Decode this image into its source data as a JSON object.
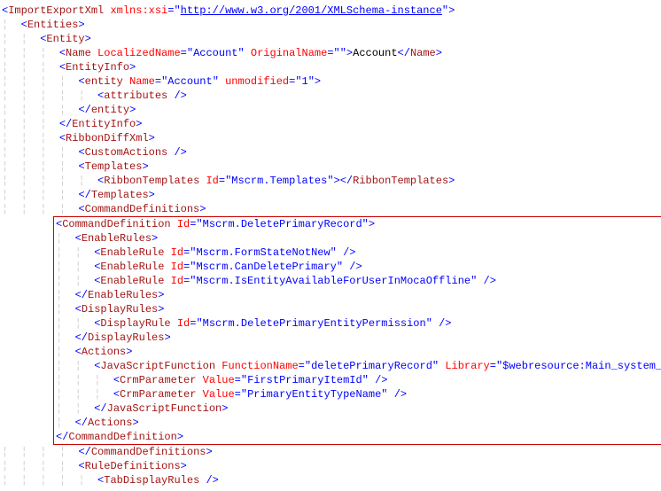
{
  "lines": {
    "l1": {
      "indent": "",
      "parts": [
        [
          "pun",
          "<"
        ],
        [
          "tag",
          "ImportExportXml"
        ],
        [
          "text",
          " "
        ],
        [
          "attrname",
          "xmlns:xsi"
        ],
        [
          "pun",
          "="
        ],
        [
          "attrval",
          "\""
        ],
        [
          "link",
          "http://www.w3.org/2001/XMLSchema-instance"
        ],
        [
          "attrval",
          "\""
        ],
        [
          "pun",
          ">"
        ]
      ]
    },
    "l2": {
      "indent": "·",
      "parts": [
        [
          "pun",
          "<"
        ],
        [
          "tag",
          "Entities"
        ],
        [
          "pun",
          ">"
        ]
      ]
    },
    "l3": {
      "indent": "··",
      "parts": [
        [
          "pun",
          "<"
        ],
        [
          "tag",
          "Entity"
        ],
        [
          "pun",
          ">"
        ]
      ]
    },
    "l4": {
      "indent": "···",
      "parts": [
        [
          "pun",
          "<"
        ],
        [
          "tag",
          "Name"
        ],
        [
          "text",
          " "
        ],
        [
          "attrname",
          "LocalizedName"
        ],
        [
          "pun",
          "="
        ],
        [
          "attrval",
          "\"Account\""
        ],
        [
          "text",
          " "
        ],
        [
          "attrname",
          "OriginalName"
        ],
        [
          "pun",
          "="
        ],
        [
          "attrval",
          "\"\""
        ],
        [
          "pun",
          ">"
        ],
        [
          "text",
          "Account"
        ],
        [
          "pun",
          "</"
        ],
        [
          "tag",
          "Name"
        ],
        [
          "pun",
          ">"
        ]
      ]
    },
    "l5": {
      "indent": "···",
      "parts": [
        [
          "pun",
          "<"
        ],
        [
          "tag",
          "EntityInfo"
        ],
        [
          "pun",
          ">"
        ]
      ]
    },
    "l6": {
      "indent": "····",
      "parts": [
        [
          "pun",
          "<"
        ],
        [
          "tag",
          "entity"
        ],
        [
          "text",
          " "
        ],
        [
          "attrname",
          "Name"
        ],
        [
          "pun",
          "="
        ],
        [
          "attrval",
          "\"Account\""
        ],
        [
          "text",
          " "
        ],
        [
          "attrname",
          "unmodified"
        ],
        [
          "pun",
          "="
        ],
        [
          "attrval",
          "\"1\""
        ],
        [
          "pun",
          ">"
        ]
      ]
    },
    "l7": {
      "indent": "·····",
      "parts": [
        [
          "pun",
          "<"
        ],
        [
          "tag",
          "attributes"
        ],
        [
          "text",
          " "
        ],
        [
          "pun",
          "/>"
        ]
      ]
    },
    "l8": {
      "indent": "····",
      "parts": [
        [
          "pun",
          "</"
        ],
        [
          "tag",
          "entity"
        ],
        [
          "pun",
          ">"
        ]
      ]
    },
    "l9": {
      "indent": "···",
      "parts": [
        [
          "pun",
          "</"
        ],
        [
          "tag",
          "EntityInfo"
        ],
        [
          "pun",
          ">"
        ]
      ]
    },
    "l10": {
      "indent": "···",
      "parts": [
        [
          "pun",
          "<"
        ],
        [
          "tag",
          "RibbonDiffXml"
        ],
        [
          "pun",
          ">"
        ]
      ]
    },
    "l11": {
      "indent": "····",
      "parts": [
        [
          "pun",
          "<"
        ],
        [
          "tag",
          "CustomActions"
        ],
        [
          "text",
          " "
        ],
        [
          "pun",
          "/>"
        ]
      ]
    },
    "l12": {
      "indent": "····",
      "parts": [
        [
          "pun",
          "<"
        ],
        [
          "tag",
          "Templates"
        ],
        [
          "pun",
          ">"
        ]
      ]
    },
    "l13": {
      "indent": "·····",
      "parts": [
        [
          "pun",
          "<"
        ],
        [
          "tag",
          "RibbonTemplates"
        ],
        [
          "text",
          " "
        ],
        [
          "attrname",
          "Id"
        ],
        [
          "pun",
          "="
        ],
        [
          "attrval",
          "\"Mscrm.Templates\""
        ],
        [
          "pun",
          ">"
        ],
        [
          "pun",
          "</"
        ],
        [
          "tag",
          "RibbonTemplates"
        ],
        [
          "pun",
          ">"
        ]
      ]
    },
    "l14": {
      "indent": "····",
      "parts": [
        [
          "pun",
          "</"
        ],
        [
          "tag",
          "Templates"
        ],
        [
          "pun",
          ">"
        ]
      ]
    },
    "l15": {
      "indent": "····",
      "parts": [
        [
          "pun",
          "<"
        ],
        [
          "tag",
          "CommandDefinitions"
        ],
        [
          "pun",
          ">"
        ]
      ]
    },
    "l16": {
      "indent": "",
      "parts": [
        [
          "pun",
          "<"
        ],
        [
          "tag",
          "CommandDefinition"
        ],
        [
          "text",
          " "
        ],
        [
          "attrname",
          "Id"
        ],
        [
          "pun",
          "="
        ],
        [
          "attrval",
          "\"Mscrm.DeletePrimaryRecord\""
        ],
        [
          "pun",
          ">"
        ]
      ]
    },
    "l17": {
      "indent": "·",
      "parts": [
        [
          "pun",
          "<"
        ],
        [
          "tag",
          "EnableRules"
        ],
        [
          "pun",
          ">"
        ]
      ]
    },
    "l18": {
      "indent": "··",
      "parts": [
        [
          "pun",
          "<"
        ],
        [
          "tag",
          "EnableRule"
        ],
        [
          "text",
          " "
        ],
        [
          "attrname",
          "Id"
        ],
        [
          "pun",
          "="
        ],
        [
          "attrval",
          "\"Mscrm.FormStateNotNew\""
        ],
        [
          "text",
          " "
        ],
        [
          "pun",
          "/>"
        ]
      ]
    },
    "l19": {
      "indent": "··",
      "parts": [
        [
          "pun",
          "<"
        ],
        [
          "tag",
          "EnableRule"
        ],
        [
          "text",
          " "
        ],
        [
          "attrname",
          "Id"
        ],
        [
          "pun",
          "="
        ],
        [
          "attrval",
          "\"Mscrm.CanDeletePrimary\""
        ],
        [
          "text",
          " "
        ],
        [
          "pun",
          "/>"
        ]
      ]
    },
    "l20": {
      "indent": "··",
      "parts": [
        [
          "pun",
          "<"
        ],
        [
          "tag",
          "EnableRule"
        ],
        [
          "text",
          " "
        ],
        [
          "attrname",
          "Id"
        ],
        [
          "pun",
          "="
        ],
        [
          "attrval",
          "\"Mscrm.IsEntityAvailableForUserInMocaOffline\""
        ],
        [
          "text",
          " "
        ],
        [
          "pun",
          "/>"
        ]
      ]
    },
    "l21": {
      "indent": "·",
      "parts": [
        [
          "pun",
          "</"
        ],
        [
          "tag",
          "EnableRules"
        ],
        [
          "pun",
          ">"
        ]
      ]
    },
    "l22": {
      "indent": "·",
      "parts": [
        [
          "pun",
          "<"
        ],
        [
          "tag",
          "DisplayRules"
        ],
        [
          "pun",
          ">"
        ]
      ]
    },
    "l23": {
      "indent": "··",
      "parts": [
        [
          "pun",
          "<"
        ],
        [
          "tag",
          "DisplayRule"
        ],
        [
          "text",
          " "
        ],
        [
          "attrname",
          "Id"
        ],
        [
          "pun",
          "="
        ],
        [
          "attrval",
          "\"Mscrm.DeletePrimaryEntityPermission\""
        ],
        [
          "text",
          " "
        ],
        [
          "pun",
          "/>"
        ]
      ]
    },
    "l24": {
      "indent": "·",
      "parts": [
        [
          "pun",
          "</"
        ],
        [
          "tag",
          "DisplayRules"
        ],
        [
          "pun",
          ">"
        ]
      ]
    },
    "l25": {
      "indent": "·",
      "parts": [
        [
          "pun",
          "<"
        ],
        [
          "tag",
          "Actions"
        ],
        [
          "pun",
          ">"
        ]
      ]
    },
    "l26": {
      "indent": "··",
      "parts": [
        [
          "pun",
          "<"
        ],
        [
          "tag",
          "JavaScriptFunction"
        ],
        [
          "text",
          " "
        ],
        [
          "attrname",
          "FunctionName"
        ],
        [
          "pun",
          "="
        ],
        [
          "attrval",
          "\"deletePrimaryRecord\""
        ],
        [
          "text",
          " "
        ],
        [
          "attrname",
          "Library"
        ],
        [
          "pun",
          "="
        ],
        [
          "attrval",
          "\"$webresource:Main_system_library.js\""
        ],
        [
          "pun",
          ">"
        ]
      ]
    },
    "l27": {
      "indent": "···",
      "parts": [
        [
          "pun",
          "<"
        ],
        [
          "tag",
          "CrmParameter"
        ],
        [
          "text",
          " "
        ],
        [
          "attrname",
          "Value"
        ],
        [
          "pun",
          "="
        ],
        [
          "attrval",
          "\"FirstPrimaryItemId\""
        ],
        [
          "text",
          " "
        ],
        [
          "pun",
          "/>"
        ]
      ]
    },
    "l28": {
      "indent": "···",
      "parts": [
        [
          "pun",
          "<"
        ],
        [
          "tag",
          "CrmParameter"
        ],
        [
          "text",
          " "
        ],
        [
          "attrname",
          "Value"
        ],
        [
          "pun",
          "="
        ],
        [
          "attrval",
          "\"PrimaryEntityTypeName\""
        ],
        [
          "text",
          " "
        ],
        [
          "pun",
          "/>"
        ]
      ]
    },
    "l29": {
      "indent": "··",
      "parts": [
        [
          "pun",
          "</"
        ],
        [
          "tag",
          "JavaScriptFunction"
        ],
        [
          "pun",
          ">"
        ]
      ]
    },
    "l30": {
      "indent": "·",
      "parts": [
        [
          "pun",
          "</"
        ],
        [
          "tag",
          "Actions"
        ],
        [
          "pun",
          ">"
        ]
      ]
    },
    "l31": {
      "indent": "",
      "parts": [
        [
          "pun",
          "</"
        ],
        [
          "tag",
          "CommandDefinition"
        ],
        [
          "pun",
          ">"
        ]
      ]
    },
    "l32": {
      "indent": "····",
      "parts": [
        [
          "pun",
          "</"
        ],
        [
          "tag",
          "CommandDefinitions"
        ],
        [
          "pun",
          ">"
        ]
      ]
    },
    "l33": {
      "indent": "····",
      "parts": [
        [
          "pun",
          "<"
        ],
        [
          "tag",
          "RuleDefinitions"
        ],
        [
          "pun",
          ">"
        ]
      ]
    },
    "l34": {
      "indent": "·····",
      "parts": [
        [
          "pun",
          "<"
        ],
        [
          "tag",
          "TabDisplayRules"
        ],
        [
          "text",
          " "
        ],
        [
          "pun",
          "/>"
        ]
      ]
    }
  }
}
